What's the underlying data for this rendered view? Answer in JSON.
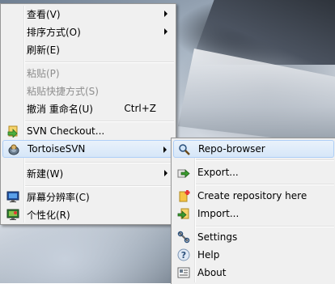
{
  "main_menu": {
    "items": [
      {
        "label": "查看(V)",
        "submenu": true
      },
      {
        "label": "排序方式(O)",
        "submenu": true
      },
      {
        "label": "刷新(E)"
      },
      {
        "label": "粘贴(P)",
        "disabled": true
      },
      {
        "label": "粘贴快捷方式(S)",
        "disabled": true
      },
      {
        "label": "撤消 重命名(U)",
        "shortcut": "Ctrl+Z"
      },
      {
        "label": "SVN Checkout...",
        "icon": "svn-checkout-icon"
      },
      {
        "label": "TortoiseSVN",
        "icon": "tortoisesvn-icon",
        "submenu": true,
        "highlighted": true
      },
      {
        "label": "新建(W)",
        "submenu": true
      },
      {
        "label": "屏幕分辨率(C)",
        "icon": "screen-resolution-icon"
      },
      {
        "label": "个性化(R)",
        "icon": "personalize-icon"
      }
    ]
  },
  "submenu": {
    "items": [
      {
        "label": "Repo-browser",
        "icon": "repo-browser-icon",
        "highlighted": true
      },
      {
        "label": "Export...",
        "icon": "export-icon"
      },
      {
        "label": "Create repository here",
        "icon": "create-repository-icon"
      },
      {
        "label": "Import...",
        "icon": "import-icon"
      },
      {
        "label": "Settings",
        "icon": "settings-icon"
      },
      {
        "label": "Help",
        "icon": "help-icon"
      },
      {
        "label": "About",
        "icon": "about-icon"
      }
    ]
  },
  "colors": {
    "menu_bg": "#f0f0f0",
    "highlight_border": "#aecff7",
    "disabled_text": "#8d8d8d"
  }
}
